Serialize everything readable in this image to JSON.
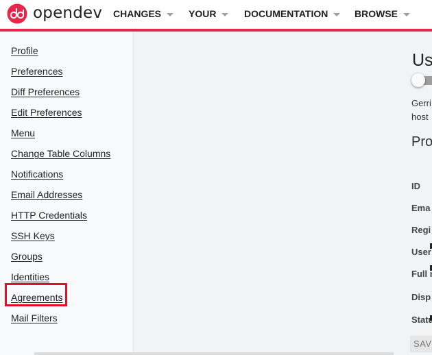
{
  "header": {
    "brand": "opendev",
    "nav": [
      {
        "label": "CHANGES"
      },
      {
        "label": "YOUR"
      },
      {
        "label": "DOCUMENTATION"
      },
      {
        "label": "BROWSE"
      }
    ],
    "accent_color": "#e8264a"
  },
  "sidebar": {
    "items": [
      {
        "label": "Profile"
      },
      {
        "label": "Preferences"
      },
      {
        "label": "Diff Preferences"
      },
      {
        "label": "Edit Preferences"
      },
      {
        "label": "Menu"
      },
      {
        "label": "Change Table Columns"
      },
      {
        "label": "Notifications"
      },
      {
        "label": "Email Addresses"
      },
      {
        "label": "HTTP Credentials"
      },
      {
        "label": "SSH Keys"
      },
      {
        "label": "Groups"
      },
      {
        "label": "Identities"
      },
      {
        "label": "Agreements"
      },
      {
        "label": "Mail Filters"
      }
    ],
    "highlighted_item": "Agreements",
    "highlight_color": "#e0102a"
  },
  "panel": {
    "title": "Us",
    "toggle_state": "off",
    "text_line1": "Gerri",
    "text_line2": "host",
    "section_title": "Pro",
    "fields": [
      {
        "label": "ID"
      },
      {
        "label": "Ema"
      },
      {
        "label": "Regi"
      },
      {
        "label": "User"
      },
      {
        "label": "Full r"
      },
      {
        "label": "Disp"
      },
      {
        "label": "Statu"
      }
    ],
    "save_label": "SAV"
  }
}
